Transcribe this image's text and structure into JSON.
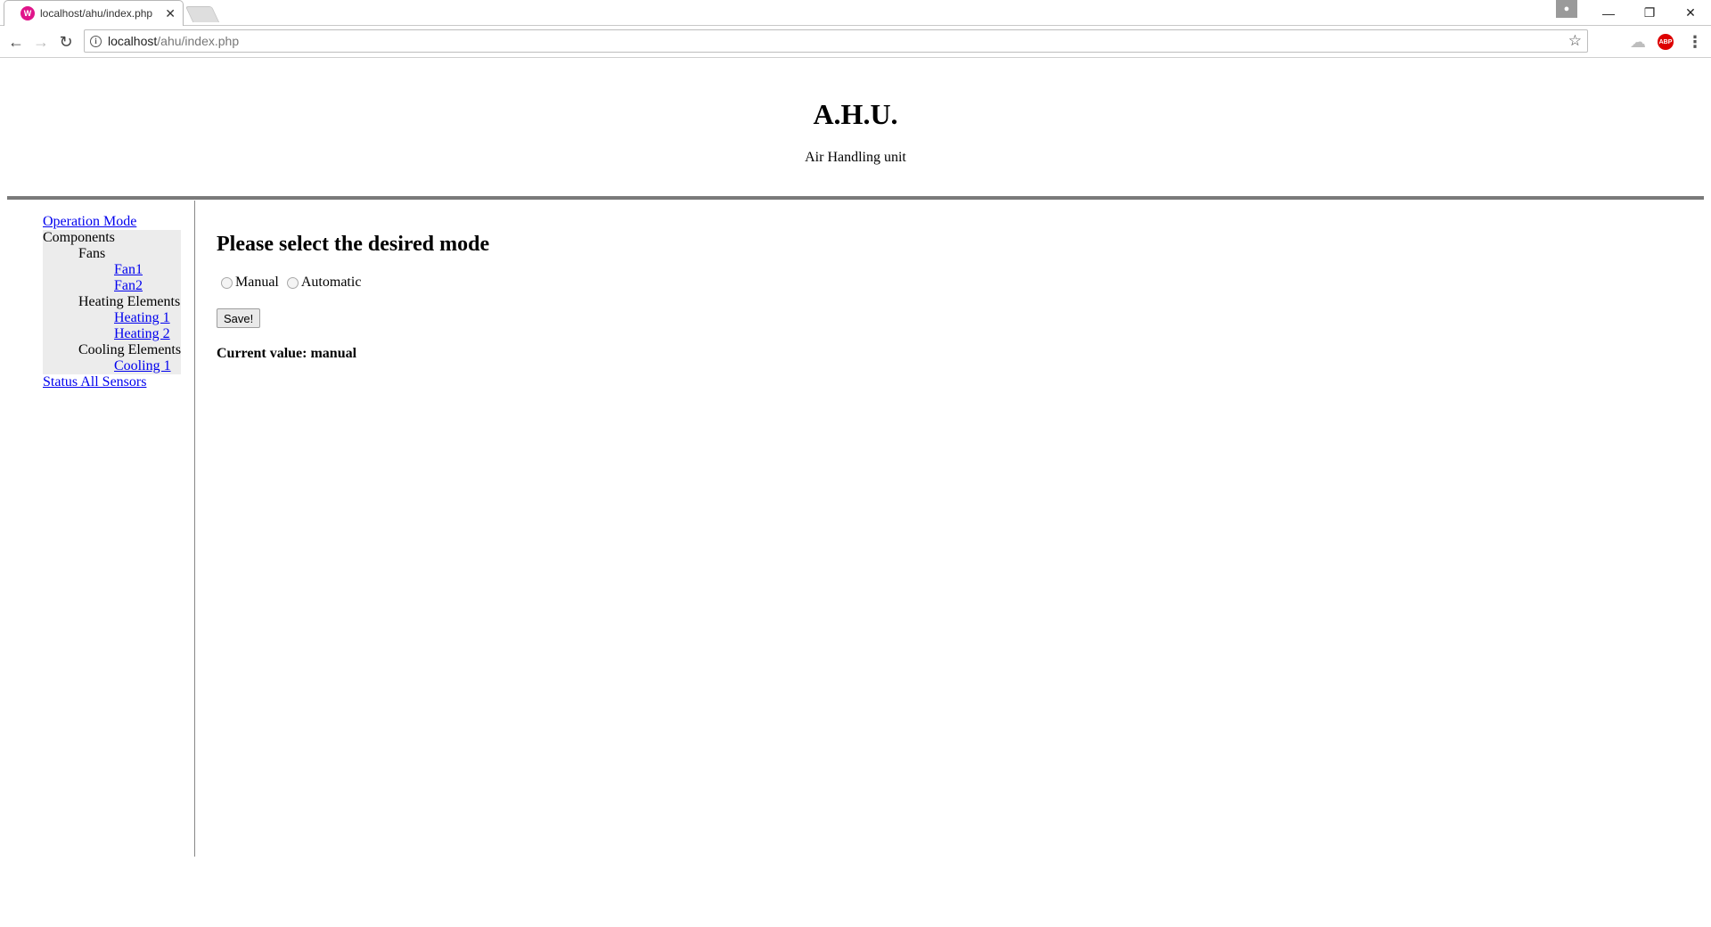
{
  "browser": {
    "tab_title": "localhost/ahu/index.php",
    "tab_favicon": "W",
    "address_host": "localhost",
    "address_path": "/ahu/index.php",
    "abp_label": "ABP"
  },
  "header": {
    "title": "A.H.U.",
    "subtitle": "Air Handling unit"
  },
  "sidebar": {
    "operation_mode": "Operation Mode",
    "components": "Components",
    "fans": "Fans",
    "fan1": "Fan1",
    "fan2": "Fan2",
    "heating_elements": "Heating Elements",
    "heating1": "Heating 1",
    "heating2": "Heating 2",
    "cooling_elements": "Cooling Elements",
    "cooling1": "Cooling 1",
    "status_all_sensors": "Status All Sensors"
  },
  "main": {
    "heading": "Please select the desired mode",
    "option_manual": "Manual",
    "option_automatic": "Automatic",
    "save_label": "Save!",
    "current_value": "Current value: manual"
  }
}
